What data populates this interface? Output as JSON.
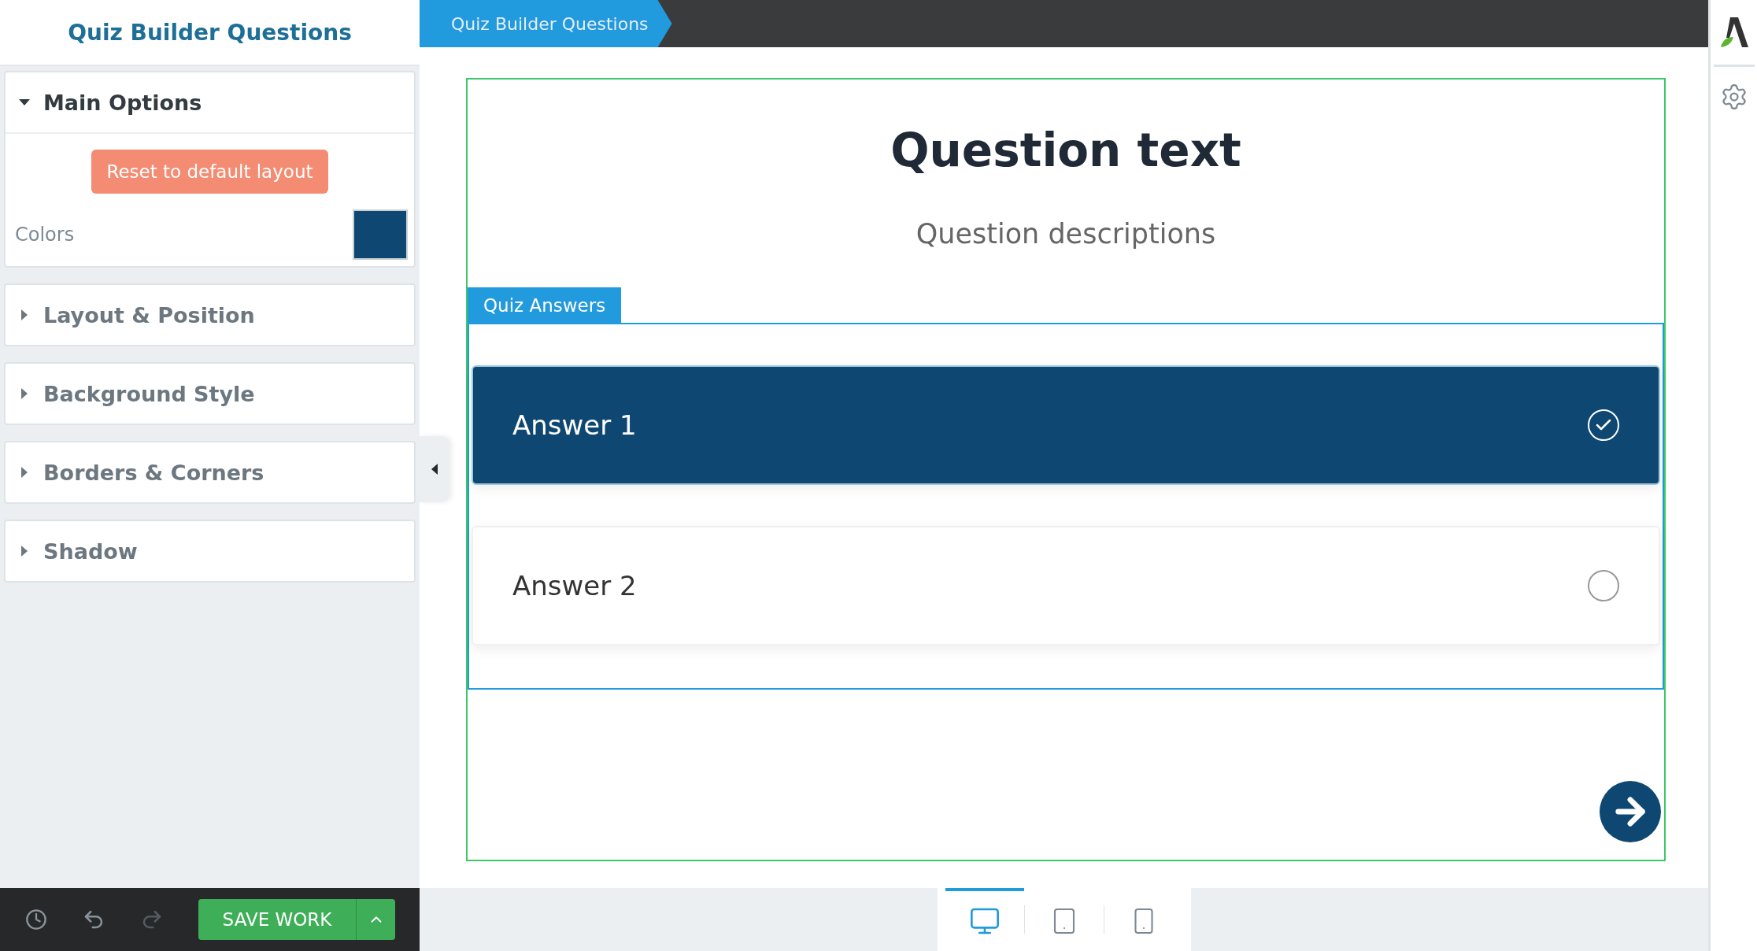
{
  "sidebar": {
    "title": "Quiz Builder Questions",
    "sections": [
      {
        "title": "Main Options",
        "expanded": true,
        "reset_button": "Reset to default layout",
        "colors_label": "Colors",
        "color": "#0e4872"
      },
      {
        "title": "Layout & Position",
        "expanded": false
      },
      {
        "title": "Background Style",
        "expanded": false
      },
      {
        "title": "Borders & Corners",
        "expanded": false
      },
      {
        "title": "Shadow",
        "expanded": false
      }
    ]
  },
  "breadcrumb": "Quiz Builder Questions",
  "question": {
    "title": "Question text",
    "description": "Question descriptions",
    "answers_tab": "Quiz Answers",
    "answers": [
      {
        "label": "Answer 1",
        "selected": true
      },
      {
        "label": "Answer 2",
        "selected": false
      }
    ]
  },
  "footer": {
    "save_button": "SAVE WORK"
  },
  "devices": [
    {
      "kind": "desktop",
      "selected": true
    },
    {
      "kind": "tablet",
      "selected": false
    },
    {
      "kind": "phone",
      "selected": false
    }
  ]
}
